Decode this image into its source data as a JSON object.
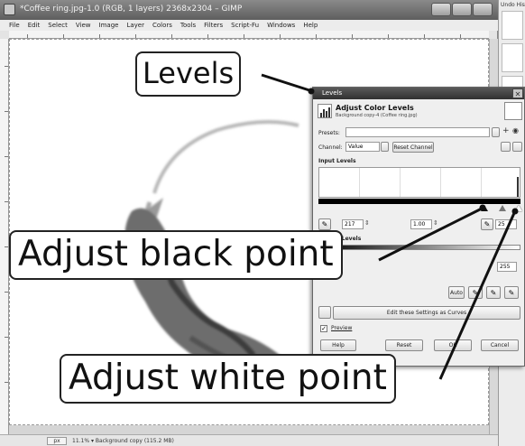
{
  "window": {
    "title": "*Coffee ring.jpg-1.0 (RGB, 1 layers) 2368x2304 – GIMP",
    "menu": [
      "File",
      "Edit",
      "Select",
      "View",
      "Image",
      "Layer",
      "Colors",
      "Tools",
      "Filters",
      "Script-Fu",
      "Windows",
      "Help"
    ]
  },
  "dock": {
    "title": "Undo His"
  },
  "status": {
    "unit": "px",
    "zoom": "11.1% ▾ Background copy (115.2 MB)"
  },
  "levels_dialog": {
    "title": "Levels",
    "heading": "Adjust Color Levels",
    "subheading": "Background copy-4 (Coffee ring.jpg)",
    "presets_label": "Presets:",
    "channel_label": "Channel:",
    "channel_value": "Value",
    "reset_channel": "Reset Channel",
    "input_levels_label": "Input Levels",
    "input_low": "217",
    "input_gamma": "1.00",
    "input_high": "25",
    "output_levels_label": "Output Levels",
    "output_high": "255",
    "auto_label": "Auto",
    "edit_curves": "Edit these Settings as Curves",
    "preview_label": "Preview",
    "help_label": "Help",
    "reset_label": "Reset",
    "ok_label": "OK",
    "cancel_label": "Cancel"
  },
  "callouts": {
    "levels": "Levels",
    "black_point": "Adjust black point",
    "white_point": "Adjust white point"
  },
  "icons": [
    "gimp-image-icon",
    "eyedropper-icon",
    "close-icon",
    "levels-icon"
  ],
  "colors": {
    "title_bar": "#5e5e5e",
    "dialog_title": "#303030",
    "callout_border": "#222222"
  }
}
